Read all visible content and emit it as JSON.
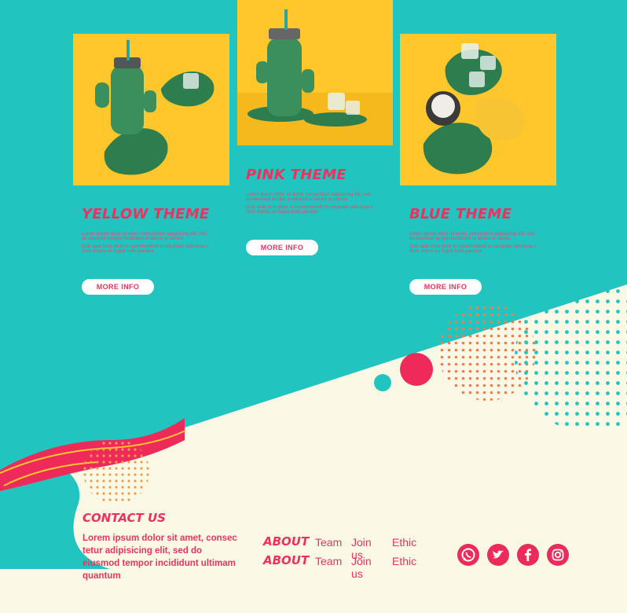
{
  "cards": [
    {
      "title": "YELLOW THEME",
      "text1": "Lorem ipsum dolor sit amet, consectetur adipisicing elit, sed do eiusmod tempor incididunt ut labore et dolore.",
      "text2": "Duis aute irure dolor in reprehenderit in voluptate velit esse cillum dolore eu fugiat nulla pariatur.",
      "button": "MORE INFO"
    },
    {
      "title": "PINK THEME",
      "text1": "Lorem ipsum dolor sit amet, consectetur adipisicing elit, sed do eiusmod tempor incididunt ut labore et dolore.",
      "text2": "Duis aute irure dolor in reprehenderit in voluptate velit esse cillum dolore eu fugiat nulla pariatur.",
      "button": "MORE INFO"
    },
    {
      "title": "BLUE THEME",
      "text1": "Lorem ipsum dolor sit amet, consectetur adipisicing elit, sed do eiusmod tempor incididunt ut labore et dolore.",
      "text2": "Duis aute irure dolor in reprehenderit in voluptate velit esse cillum dolore eu fugiat nulla pariatur.",
      "button": "MORE INFO"
    }
  ],
  "contact": {
    "title": "CONTACT US",
    "text": "Lorem ipsum dolor sit amet, consec tetur adipisicing elit, sed do eiusmod tempor incididunt ultimam quantum"
  },
  "about_rows": [
    {
      "label": "ABOUT",
      "links": [
        "Team",
        "Join us",
        "Ethic"
      ]
    },
    {
      "label": "ABOUT",
      "links": [
        "Team",
        "Join us",
        "Ethic"
      ]
    }
  ],
  "social_icons": [
    "whatsapp-icon",
    "twitter-icon",
    "facebook-icon",
    "instagram-icon"
  ],
  "colors": {
    "teal": "#21c4bf",
    "pink": "#ee2a5a",
    "yellow": "#ffc62a",
    "cream": "#fcf8e6",
    "orange_dots": "#f57d4a"
  }
}
